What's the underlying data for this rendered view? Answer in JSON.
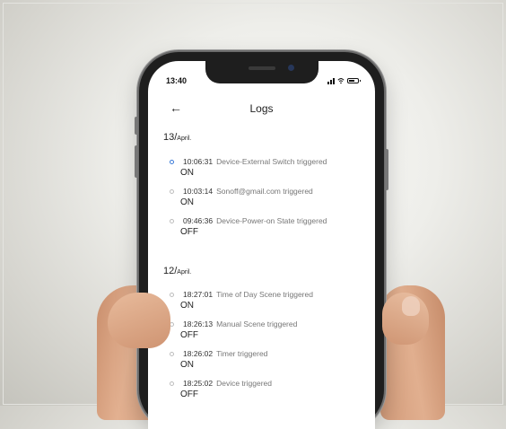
{
  "status": {
    "time": "13:40"
  },
  "header": {
    "title": "Logs",
    "back_icon": "arrow-left-icon"
  },
  "groups": [
    {
      "date": "13/",
      "month": "April.",
      "entries": [
        {
          "time": "10:06:31",
          "event": "Device-External Switch triggered",
          "state": "ON",
          "active": true
        },
        {
          "time": "10:03:14",
          "event": "Sonoff@gmail.com triggered",
          "state": "ON",
          "active": false
        },
        {
          "time": "09:46:36",
          "event": "Device-Power-on State triggered",
          "state": "OFF",
          "active": false
        }
      ]
    },
    {
      "date": "12/",
      "month": "April.",
      "entries": [
        {
          "time": "18:27:01",
          "event": "Time of Day Scene triggered",
          "state": "ON",
          "active": false
        },
        {
          "time": "18:26:13",
          "event": "Manual Scene triggered",
          "state": "OFF",
          "active": false
        },
        {
          "time": "18:26:02",
          "event": "Timer triggered",
          "state": "ON",
          "active": false
        },
        {
          "time": "18:25:02",
          "event": "Device triggered",
          "state": "OFF",
          "active": false
        }
      ]
    }
  ],
  "colors": {
    "active_dot": "#3a7ad8",
    "inactive_dot": "#bdbdbd"
  }
}
